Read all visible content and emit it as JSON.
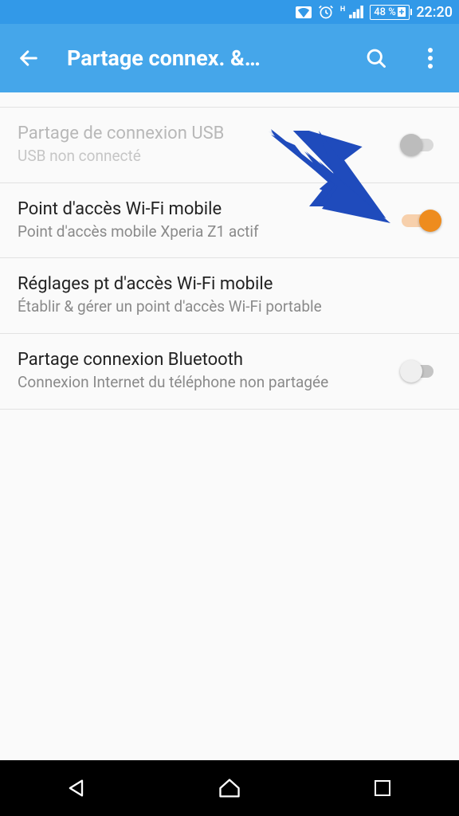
{
  "status": {
    "signal_tag": "H",
    "battery": "48 %",
    "time": "22:20"
  },
  "header": {
    "title": "Partage connex. &…"
  },
  "items": [
    {
      "title": "Partage de connexion USB",
      "subtitle": "USB non connecté",
      "enabled": false,
      "toggle": true,
      "checked": false
    },
    {
      "title": "Point d'accès Wi-Fi mobile",
      "subtitle": "Point d'accès mobile Xperia Z1 actif",
      "enabled": true,
      "toggle": true,
      "checked": true
    },
    {
      "title": "Réglages pt d'accès Wi-Fi mobile",
      "subtitle": "Établir & gérer un point d'accès Wi-Fi portable",
      "enabled": true,
      "toggle": false
    },
    {
      "title": "Partage connexion Bluetooth",
      "subtitle": "Connexion Internet du téléphone non partagée",
      "enabled": true,
      "toggle": true,
      "checked": false
    }
  ],
  "colors": {
    "accent": "#ee8c1e",
    "appbar": "#45a6ea",
    "arrow": "#1f4bbc"
  }
}
